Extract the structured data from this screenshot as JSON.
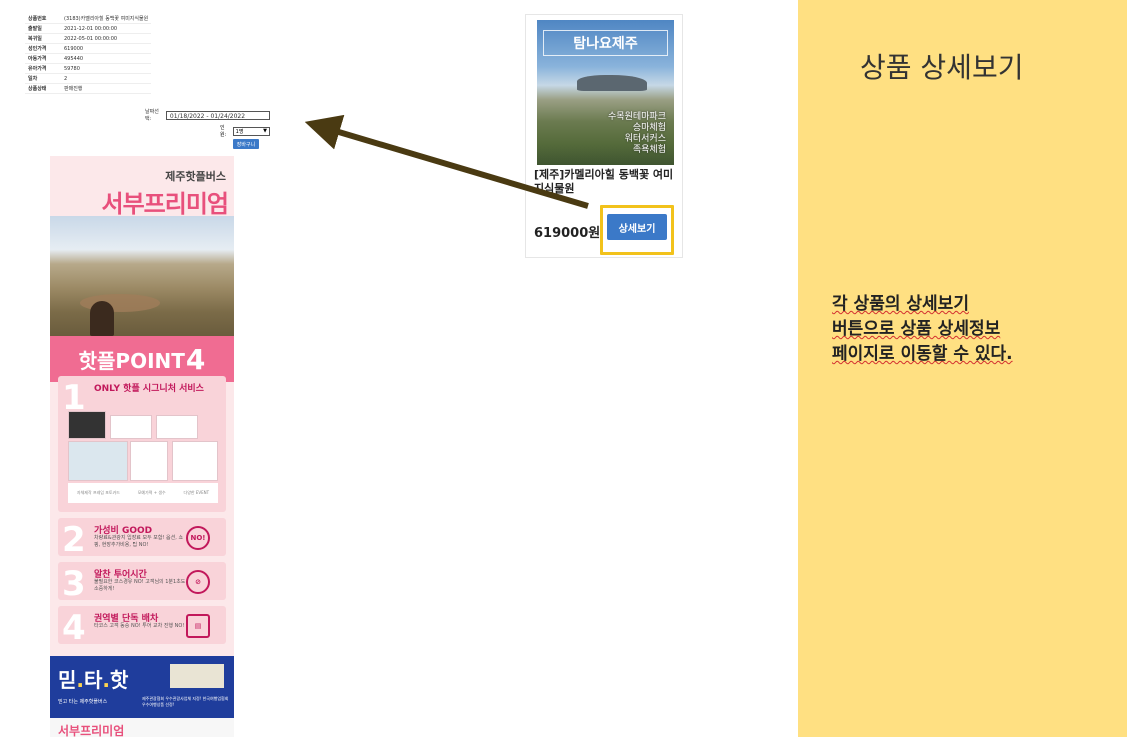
{
  "detail": {
    "info_rows": [
      {
        "label": "상품번호",
        "value": "(3183)카멜리아힐 동백꽃 여미지식물원"
      },
      {
        "label": "출발일",
        "value": "2021-12-01 00:00:00"
      },
      {
        "label": "복귀일",
        "value": "2022-05-01 00:00:00"
      },
      {
        "label": "성인가격",
        "value": "619000"
      },
      {
        "label": "아동가격",
        "value": "495440"
      },
      {
        "label": "유아가격",
        "value": "59780"
      },
      {
        "label": "일차",
        "value": "2"
      },
      {
        "label": "상품상태",
        "value": "판매진행"
      }
    ],
    "date_label": "날짜선택:",
    "date_value": "01/18/2022 - 01/24/2022",
    "people_label": "인원:",
    "people_value": "1명",
    "book_button": "장바구니"
  },
  "poster": {
    "small_title": "제주핫플버스",
    "big_title": "서부프리미엄",
    "point_label": "핫플POINT",
    "point_num": "4",
    "cards": [
      {
        "num": "1",
        "title": "ONLY 핫플 시그니처 서비스",
        "text": "카멜리아힐 2022 감성캘린더 · DC COUPON · 코스별 음료할인권",
        "captions": [
          "자체제작 프레임 포토카드",
          "모예가떡 + 생수",
          "다양한 EVENT"
        ]
      },
      {
        "num": "2",
        "title": "가성비 GOOD",
        "text": "차량료&관광지 입장료 모두 포함! 옵션, 쇼핑, 현장추가비용, 팁 NO!",
        "badge": "NO!"
      },
      {
        "num": "3",
        "title": "알찬 투어시간",
        "text": "불필요한 코스경유 NO! 고객님의 1분1초도 소중하게!"
      },
      {
        "num": "4",
        "title": "권역별 단독 배차",
        "text": "타코스 고객 동승 NO! 투어 교차 진행 NO!"
      }
    ],
    "trust": {
      "logo_a": "믿",
      "logo_b": "타",
      "logo_c": "핫",
      "sub": "믿고 타는 제주핫플버스",
      "sub2": "제주관광협회 우수관광사업체 지정! 한국여행업협회 우수여행상품 선정!"
    },
    "bottom": "서부프리미엄"
  },
  "product_card": {
    "img_title": "탐나요제주",
    "img_lines": [
      "수목원테마파크",
      "승마체험",
      "워터서커스",
      "족욕체험"
    ],
    "name": "[제주]카멜리아힐 동백꽃 여미지식물원",
    "price": "619000원",
    "detail_button": "상세보기"
  },
  "note": {
    "title": "상품 상세보기",
    "body_lines": [
      "각 상품의 상세보기",
      "버튼으로 상품 상세정보",
      "페이지로 이동할 수 있다."
    ]
  },
  "colors": {
    "accent_yellow": "#ffe082",
    "highlight": "#f2c21b",
    "button_blue": "#3b79c8",
    "arrow": "#4a3a12",
    "pink": "#e8507c"
  }
}
